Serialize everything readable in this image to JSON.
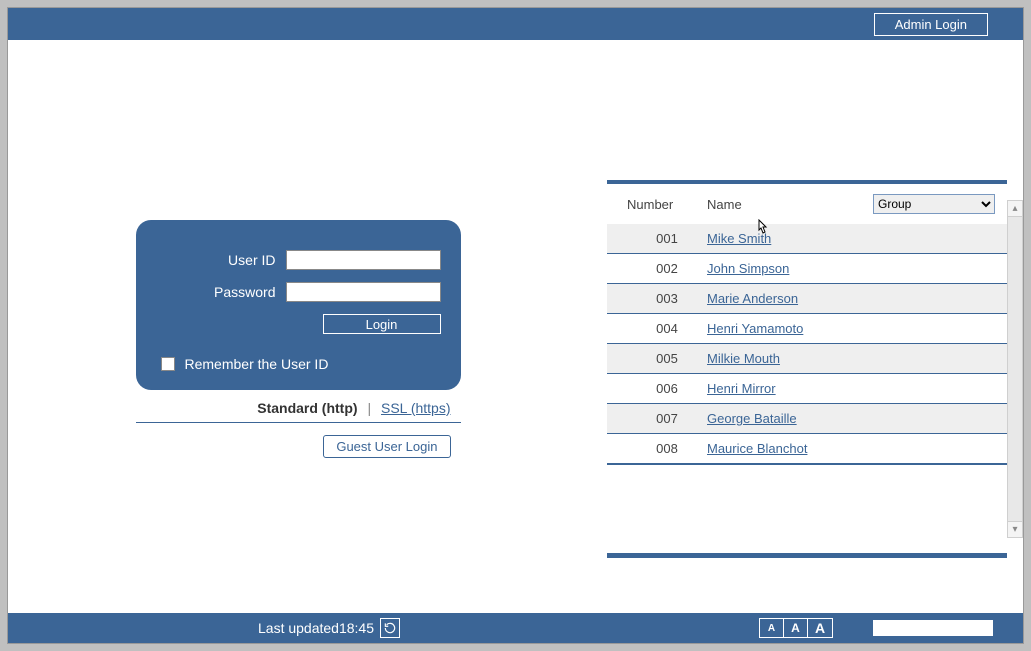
{
  "header": {
    "admin_login": "Admin Login"
  },
  "login": {
    "user_id_label": "User ID",
    "user_id_value": "",
    "password_label": "Password",
    "password_value": "",
    "login_button": "Login",
    "remember_label": "Remember the User ID",
    "remember_checked": false
  },
  "protocol": {
    "standard": "Standard (http)",
    "divider": "|",
    "ssl": "SSL (https)"
  },
  "guest": {
    "button": "Guest User Login"
  },
  "user_panel": {
    "header_number": "Number",
    "header_name": "Name",
    "group_select": {
      "selected": "Group",
      "options": [
        "Group"
      ]
    },
    "rows": [
      {
        "num": "001",
        "name": "Mike Smith"
      },
      {
        "num": "002",
        "name": "John Simpson"
      },
      {
        "num": "003",
        "name": "Marie Anderson"
      },
      {
        "num": "004",
        "name": "Henri Yamamoto"
      },
      {
        "num": "005",
        "name": "Milkie Mouth"
      },
      {
        "num": "006",
        "name": "Henri Mirror"
      },
      {
        "num": "007",
        "name": "George Bataille"
      },
      {
        "num": "008",
        "name": "Maurice Blanchot"
      }
    ]
  },
  "footer": {
    "last_updated_label": "Last updated",
    "last_updated_time": "18:45",
    "font_letter": "A"
  }
}
